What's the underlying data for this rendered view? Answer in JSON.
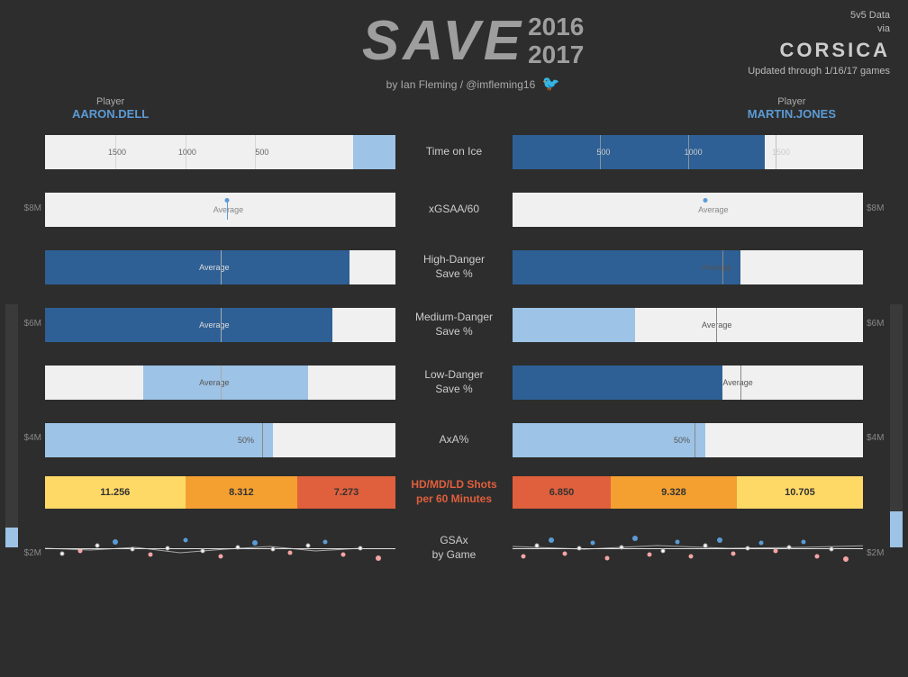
{
  "header": {
    "save_word": "SAVE",
    "year1": "2016",
    "year2": "2017",
    "byline": "by Ian Fleming / @imfleming16",
    "data_source": "5v5 Data\nvia",
    "corsica": "CORSICA",
    "updated": "Updated through 1/16/17 games"
  },
  "players": {
    "left_label": "Player",
    "left_name": "AARON.DELL",
    "right_label": "Player",
    "right_name": "MARTIN.JONES"
  },
  "salary_axis": {
    "labels": [
      "$8M",
      "$6M",
      "$4M",
      "$2M"
    ]
  },
  "rows": [
    {
      "label": "Time on Ice",
      "left_bar": {
        "type": "toi",
        "light_width": 0.12,
        "ticks": [
          1500,
          1000,
          500
        ]
      },
      "right_bar": {
        "type": "toi",
        "dark_width": 0.72,
        "ticks": [
          500,
          1000,
          1500
        ]
      }
    },
    {
      "label": "xGSAA/60",
      "left_bar": {
        "type": "avg",
        "avg_pos": 0.5
      },
      "right_bar": {
        "type": "avg",
        "avg_pos": 0.55
      }
    },
    {
      "label": "High-Danger\nSave %",
      "left_bar": {
        "type": "filled",
        "fill_width": 0.85,
        "avg_pos": 0.5
      },
      "right_bar": {
        "type": "filled",
        "fill_width": 0.65,
        "avg_pos": 0.55
      }
    },
    {
      "label": "Medium-Danger\nSave %",
      "left_bar": {
        "type": "filled",
        "fill_width": 0.8,
        "avg_pos": 0.5
      },
      "right_bar": {
        "type": "partial",
        "fill_width": 0.35,
        "avg_pos": 0.55
      }
    },
    {
      "label": "Low-Danger\nSave %",
      "left_bar": {
        "type": "filled_mid",
        "fill_start": 0.3,
        "fill_width": 0.45,
        "avg_pos": 0.5
      },
      "right_bar": {
        "type": "filled",
        "fill_width": 0.6,
        "avg_pos": 0.65
      }
    },
    {
      "label": "AxA%",
      "left_bar": {
        "type": "fifty",
        "fill_width": 0.65
      },
      "right_bar": {
        "type": "fifty",
        "fill_width": 0.55
      }
    },
    {
      "label": "HD/MD/LD Shots\nper 60 Minutes",
      "left_bar": {
        "type": "shots",
        "segments": [
          {
            "val": "11.256",
            "width": 0.4,
            "color": "#ffd966"
          },
          {
            "val": "8.312",
            "width": 0.32,
            "color": "#f4a030"
          },
          {
            "val": "7.273",
            "width": 0.28,
            "color": "#e05f3c"
          }
        ]
      },
      "right_bar": {
        "type": "shots",
        "segments": [
          {
            "val": "6.850",
            "width": 0.28,
            "color": "#e05f3c"
          },
          {
            "val": "9.328",
            "width": 0.36,
            "color": "#f4a030"
          },
          {
            "val": "10.705",
            "width": 0.36,
            "color": "#ffd966"
          }
        ]
      }
    },
    {
      "label": "GSAx\nby Game"
    }
  ]
}
